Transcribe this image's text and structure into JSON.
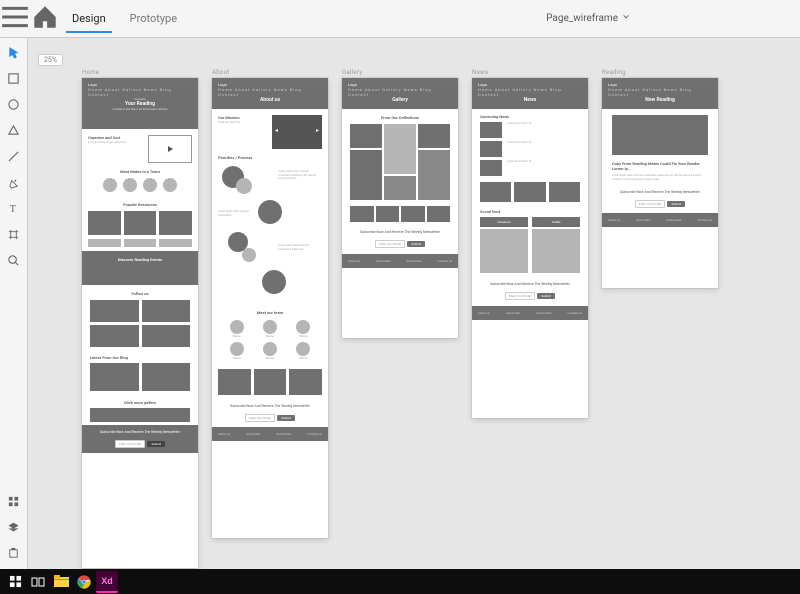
{
  "app": {
    "tabs": {
      "design": "Design",
      "prototype": "Prototype"
    },
    "document_name": "Page_wireframe",
    "zoom_label": "25%"
  },
  "artboards": {
    "home": {
      "label": "Home"
    },
    "about": {
      "label": "About"
    },
    "gallery": {
      "label": "Gallery"
    },
    "news": {
      "label": "News"
    },
    "reading": {
      "label": "Reading"
    }
  },
  "wireframe": {
    "logo": "Logo",
    "nav_items": "Home About Gallery News Blog Contact",
    "home": {
      "hero_kicker": "Increase",
      "hero_title": "Your Reading",
      "hero_sub": "Curabitur sed dolor sit amet justo ultrices",
      "section1_title": "Organize and Sort",
      "section1_sub": "your growing book collection",
      "meet_label": "Meet Mates In a Team",
      "resources_label": "Popular Resources",
      "events_hero": "Discover Reading Events",
      "follow_label": "Follow us",
      "latest_label": "Latest From Our Blog",
      "more_gallery": "Click more gallery"
    },
    "about": {
      "hero": "About us",
      "mission": "Our Mission",
      "mission_sub": "what we fight for",
      "process": "Priorities / Process",
      "team": "Meet our team"
    },
    "gallery": {
      "hero": "Gallery",
      "from": "From Our Collections"
    },
    "news": {
      "hero": "News",
      "upcoming": "Upcoming News",
      "feed": "Social feed",
      "fb": "Facebook",
      "tw": "Twitter"
    },
    "reading": {
      "hero": "Now Reading",
      "article_title": "Copy From Reading Mates Could Fix Your Reader Lorem Ip..."
    },
    "subscribe": {
      "title": "Subscribe Now And Receive The Weekly Newsletter",
      "placeholder": "Enter Your Email",
      "button": "Submit"
    },
    "footer": {
      "col1": "About us",
      "col2": "Quick links",
      "col3": "Social links",
      "col4": "Contact us"
    }
  },
  "tools": {
    "select": "select-tool",
    "rectangle": "rectangle-tool",
    "ellipse": "ellipse-tool",
    "polygon": "polygon-tool",
    "line": "line-tool",
    "pen": "pen-tool",
    "text": "text-tool",
    "artboard": "artboard-tool",
    "zoom": "zoom-tool",
    "assets": "assets-panel",
    "layers": "layers-panel",
    "plugins": "plugins-panel"
  }
}
